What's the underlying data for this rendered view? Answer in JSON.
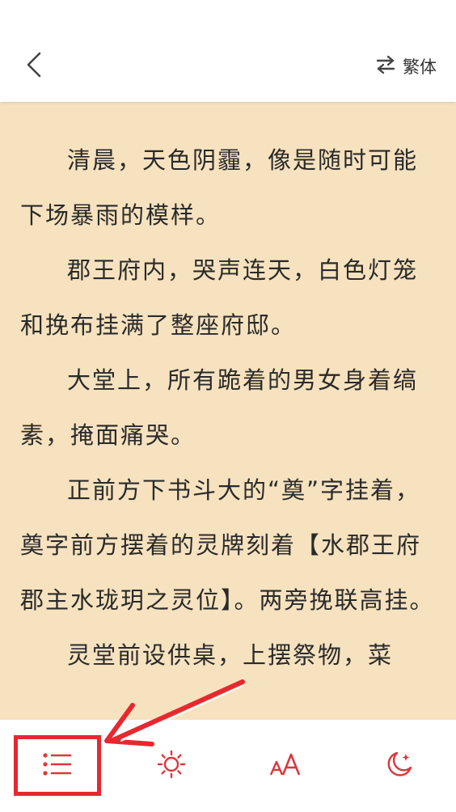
{
  "header": {
    "back_icon": "chevron-left-icon",
    "toggle_icon": "swap-arrows-icon",
    "toggle_label": "繁体"
  },
  "content": {
    "paragraphs": [
      "清晨，天色阴霾，像是随时可能下场暴雨的模样。",
      "郡王府内，哭声连天，白色灯笼和挽布挂满了整座府邸。",
      "大堂上，所有跪着的男女身着缟素，掩面痛哭。",
      "正前方下书斗大的“奠”字挂着，奠字前方摆着的灵牌刻着【水郡王府郡主水珑玥之灵位】。两旁挽联高挂。",
      "灵堂前设供桌，上摆祭物，菜"
    ],
    "background_color": "#f6e2bf"
  },
  "toolbar": {
    "items": [
      {
        "icon": "list-icon"
      },
      {
        "icon": "brightness-icon"
      },
      {
        "icon": "font-size-icon"
      },
      {
        "icon": "night-mode-icon"
      }
    ],
    "accent_color": "#d9383c"
  },
  "annotation": {
    "highlight_color": "#e8272f",
    "target": "list-icon"
  }
}
